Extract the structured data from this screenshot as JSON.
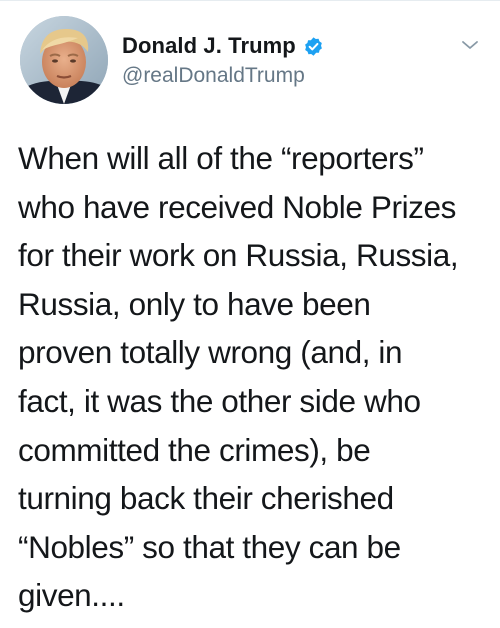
{
  "author": {
    "display_name": "Donald J. Trump",
    "handle": "@realDonaldTrump",
    "verified": true
  },
  "icons": {
    "verified": "verified-badge-icon",
    "menu": "chevron-down-icon",
    "avatar": "profile-photo"
  },
  "colors": {
    "verified_blue": "#1da1f2",
    "handle_gray": "#657786",
    "text": "#14171a"
  },
  "tweet": {
    "lines": [
      "When will all of the “reporters”",
      "who have received Noble Prizes",
      "for their work on Russia, Russia,",
      "Russia, only to have been",
      "proven totally wrong (and, in",
      "fact, it was the other side who",
      "committed the crimes), be",
      "turning back their cherished",
      "“Nobles” so that they can be",
      "given...."
    ]
  }
}
